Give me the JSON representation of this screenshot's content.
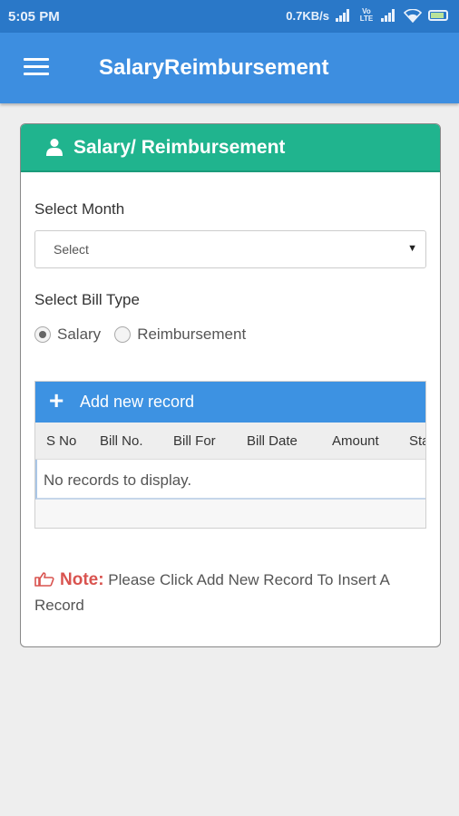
{
  "status_bar": {
    "time": "5:05 PM",
    "network_speed": "0.7KB/s",
    "volte_label": "Vo LTE"
  },
  "app_bar": {
    "title": "SalaryReimbursement"
  },
  "card": {
    "title": "Salary/ Reimbursement",
    "select_month_label": "Select Month",
    "select_month_value": "Select",
    "bill_type_label": "Select Bill Type",
    "bill_types": [
      {
        "label": "Salary",
        "checked": true
      },
      {
        "label": "Reimbursement",
        "checked": false
      }
    ],
    "grid": {
      "add_label": "Add new record",
      "columns": [
        "S No",
        "Bill No.",
        "Bill For",
        "Bill Date",
        "Amount",
        "Status"
      ],
      "empty_message": "No records to display."
    },
    "note": {
      "label": "Note:",
      "text": " Please Click Add New Record To Insert A Record"
    }
  },
  "colors": {
    "status_bar": "#2a78c8",
    "app_bar": "#3d8ee0",
    "card_header": "#20b48e",
    "grid_toolbar": "#3d92e2",
    "note_accent": "#d9534f"
  },
  "icons": [
    "menu-icon",
    "user-icon",
    "plus-icon",
    "thumbs-up-icon",
    "wifi-icon",
    "signal-icon",
    "battery-icon"
  ]
}
